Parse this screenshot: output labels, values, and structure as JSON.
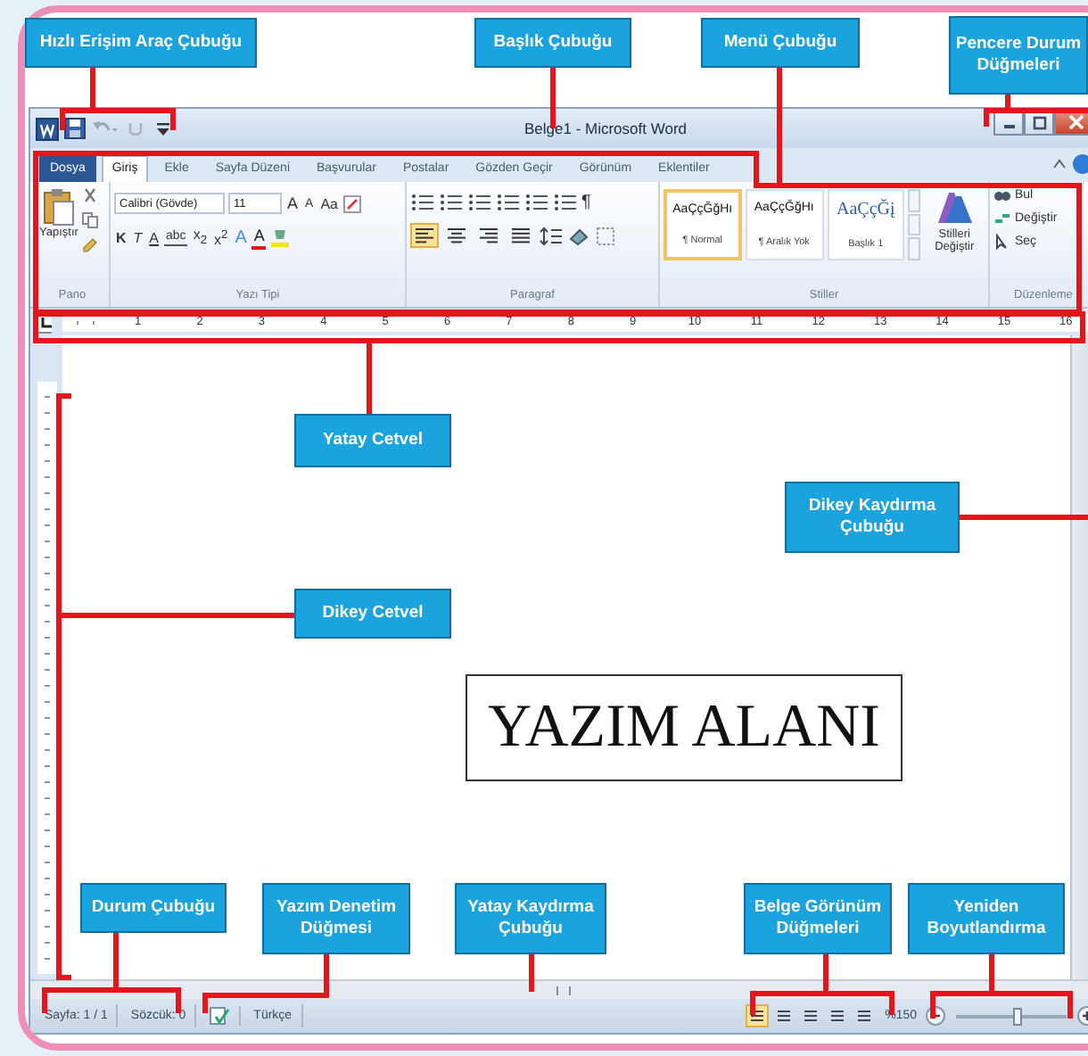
{
  "callouts": [
    "Hızlı Erişim Araç Çubuğu",
    "Başlık Çubuğu",
    "Menü Çubuğu",
    "Pencere Durum Düğmeleri",
    "Yatay Cetvel",
    "Dikey Kaydırma Çubuğu",
    "Dikey Cetvel",
    "Durum Çubuğu",
    "Yazım Denetim Düğmesi",
    "Yatay Kaydırma Çubuğu",
    "Belge Görünüm Düğmeleri",
    "Yeniden Boyutlandırma"
  ],
  "window": {
    "title": "Belge1 - Microsoft Word"
  },
  "tabs": [
    {
      "label": "Dosya",
      "kind": "file",
      "selected": false
    },
    {
      "label": "Giriş",
      "kind": "tab",
      "selected": true
    },
    {
      "label": "Ekle",
      "kind": "tab",
      "selected": false
    },
    {
      "label": "Sayfa Düzeni",
      "kind": "tab",
      "selected": false
    },
    {
      "label": "Başvurular",
      "kind": "tab",
      "selected": false
    },
    {
      "label": "Postalar",
      "kind": "tab",
      "selected": false
    },
    {
      "label": "Gözden Geçir",
      "kind": "tab",
      "selected": false
    },
    {
      "label": "Görünüm",
      "kind": "tab",
      "selected": false
    },
    {
      "label": "Eklentiler",
      "kind": "tab",
      "selected": false
    }
  ],
  "ribbon": {
    "clipboard": {
      "group": "Pano",
      "paste": "Yapıştır"
    },
    "font": {
      "group": "Yazı Tipi",
      "family": "Calibri (Gövde)",
      "size": "11",
      "row1": [
        {
          "text": "A",
          "kind": "grow"
        },
        {
          "text": "A",
          "kind": "shrink"
        },
        {
          "text": "Aa",
          "kind": "case"
        }
      ],
      "row2": [
        {
          "text": "K",
          "kind": "bold"
        },
        {
          "text": "T",
          "kind": "italic"
        },
        {
          "text": "A",
          "kind": "underline"
        },
        {
          "text": "abc",
          "kind": "strike"
        },
        {
          "text": "x$_{2}$",
          "kind": "plain"
        },
        {
          "text": "x$^{2}$",
          "kind": "plain"
        },
        {
          "text": "A",
          "kind": "effect"
        },
        {
          "text": "A",
          "kind": "color"
        }
      ]
    },
    "paragraph": {
      "group": "Paragraf",
      "pilcrow": "¶",
      "alignments": [
        {
          "kind": "left",
          "selected": true
        },
        {
          "kind": "center",
          "selected": false
        },
        {
          "kind": "right",
          "selected": false
        },
        {
          "kind": "justify",
          "selected": false
        }
      ]
    },
    "styles": {
      "group": "Stiller",
      "items": [
        {
          "preview": "AaÇçĞğHı",
          "name": "¶ Normal",
          "kind": "body",
          "selected": true
        },
        {
          "preview": "AaÇçĞğHı",
          "name": "¶ Aralık Yok",
          "kind": "body",
          "selected": false
        },
        {
          "preview": "AaÇçĞį",
          "name": "Başlık 1",
          "kind": "heading",
          "selected": false
        }
      ],
      "change": "Stilleri Değiştir"
    },
    "editing": {
      "group": "Düzenleme",
      "find": "Bul",
      "replace": "Değiştir",
      "select": "Seç"
    }
  },
  "ruler": {
    "numbers": [
      "1",
      "2",
      "3",
      "4",
      "5",
      "6",
      "7",
      "8",
      "9",
      "10",
      "11",
      "12",
      "13",
      "14",
      "15",
      "16"
    ]
  },
  "document": {
    "text": "YAZIM ALANI"
  },
  "status_bar": {
    "page": "Sayfa: 1 / 1",
    "words": "Sözcük: 0",
    "language": "Türkçe",
    "views": [
      {
        "selected": true
      },
      {
        "selected": false
      },
      {
        "selected": false
      },
      {
        "selected": false
      },
      {
        "selected": false
      }
    ],
    "zoom": "%150",
    "zoom_slider": {
      "level": 0.55
    }
  }
}
